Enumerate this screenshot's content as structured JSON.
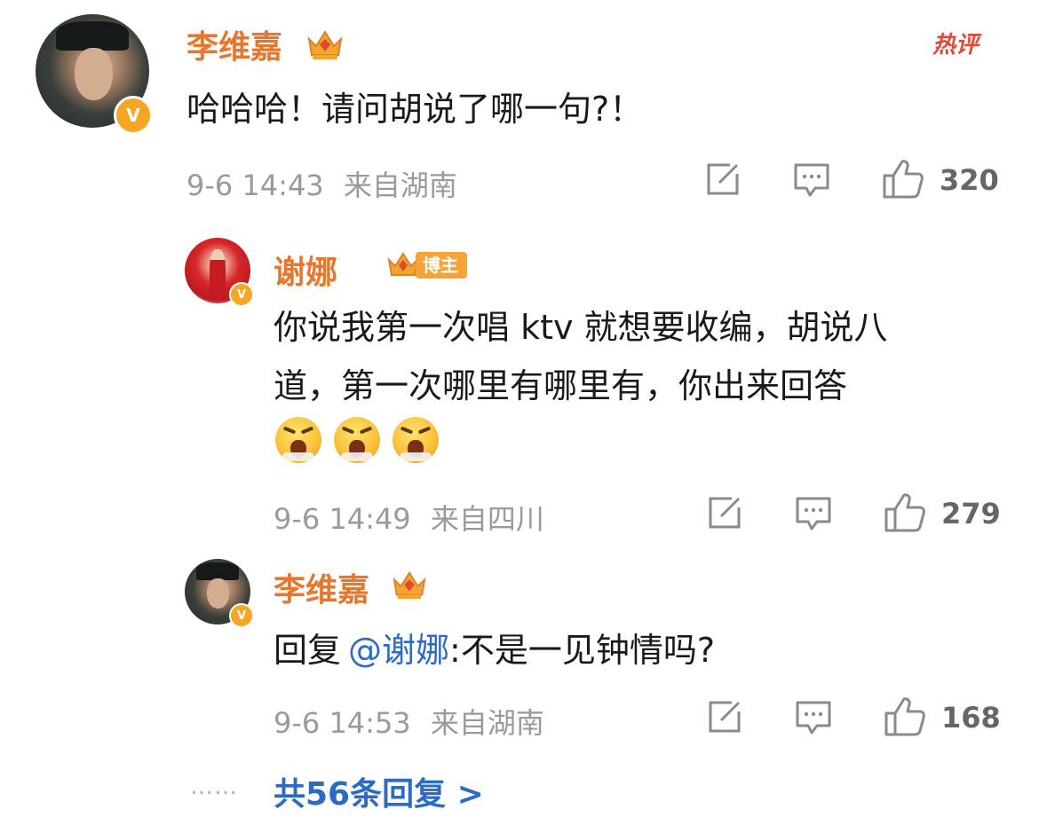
{
  "hot_label": "热评",
  "comment": {
    "username": "李维嘉",
    "text": "哈哈哈！请问胡说了哪一句?！",
    "time": "9-6 14:43",
    "location": "来自湖南",
    "likes": "320"
  },
  "replies": [
    {
      "username": "谢娜",
      "tag": "博主",
      "text_line1": "你说我第一次唱 ktv 就想要收编，胡说八",
      "text_line2": "道，第一次哪里有哪里有，你出来回答",
      "emoji_icons": [
        "angry-face-icon",
        "angry-face-icon",
        "angry-face-icon"
      ],
      "time": "9-6 14:49",
      "location": "来自四川",
      "likes": "279"
    },
    {
      "username": "李维嘉",
      "reply_prefix": "回复",
      "mention": "@谢娜",
      "text": ":不是一见钟情吗?",
      "time": "9-6 14:53",
      "location": "来自湖南",
      "likes": "168"
    }
  ],
  "more_replies": {
    "dots": "……",
    "label": "共56条回复 >"
  },
  "colors": {
    "username": "#e8772e",
    "link": "#2b6bc6",
    "meta": "#9a9a9a",
    "badge": "#f5a623",
    "hot": "#e04a3a"
  }
}
